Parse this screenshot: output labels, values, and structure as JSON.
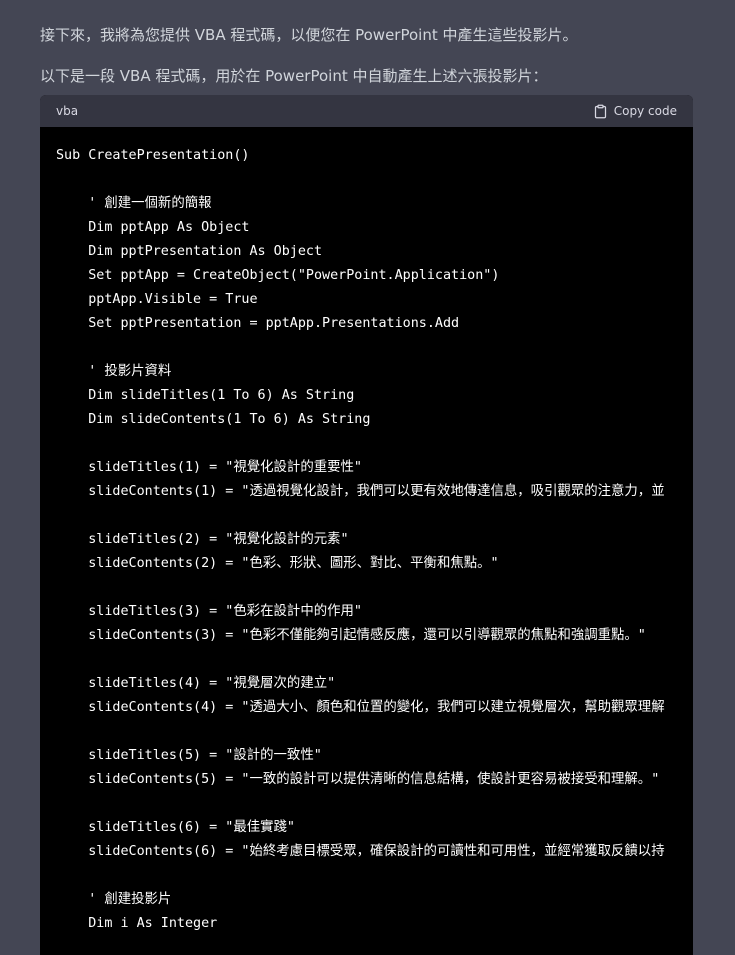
{
  "message": {
    "intro": "接下來，我將為您提供 VBA 程式碼，以便您在 PowerPoint 中產生這些投影片。",
    "lead": "以下是一段 VBA 程式碼，用於在 PowerPoint 中自動產生上述六張投影片："
  },
  "code_block": {
    "language": "vba",
    "copy_label": "Copy code",
    "lines": [
      "Sub CreatePresentation()",
      "",
      "    ' 創建一個新的簡報",
      "    Dim pptApp As Object",
      "    Dim pptPresentation As Object",
      "    Set pptApp = CreateObject(\"PowerPoint.Application\")",
      "    pptApp.Visible = True",
      "    Set pptPresentation = pptApp.Presentations.Add",
      "",
      "    ' 投影片資料",
      "    Dim slideTitles(1 To 6) As String",
      "    Dim slideContents(1 To 6) As String",
      "",
      "    slideTitles(1) = \"視覺化設計的重要性\"",
      "    slideContents(1) = \"透過視覺化設計，我們可以更有效地傳達信息，吸引觀眾的注意力，並",
      "",
      "    slideTitles(2) = \"視覺化設計的元素\"",
      "    slideContents(2) = \"色彩、形狀、圖形、對比、平衡和焦點。\"",
      "",
      "    slideTitles(3) = \"色彩在設計中的作用\"",
      "    slideContents(3) = \"色彩不僅能夠引起情感反應，還可以引導觀眾的焦點和強調重點。\"",
      "",
      "    slideTitles(4) = \"視覺層次的建立\"",
      "    slideContents(4) = \"透過大小、顏色和位置的變化，我們可以建立視覺層次，幫助觀眾理解",
      "",
      "    slideTitles(5) = \"設計的一致性\"",
      "    slideContents(5) = \"一致的設計可以提供清晰的信息結構，使設計更容易被接受和理解。\"",
      "",
      "    slideTitles(6) = \"最佳實踐\"",
      "    slideContents(6) = \"始終考慮目標受眾，確保設計的可讀性和可用性，並經常獲取反饋以持",
      "",
      "    ' 創建投影片",
      "    Dim i As Integer"
    ]
  },
  "icons": {
    "copy": "clipboard-icon"
  },
  "colors": {
    "page_background": "#444654",
    "code_header": "#343541",
    "code_background": "#000000",
    "text": "#d1d5db"
  }
}
